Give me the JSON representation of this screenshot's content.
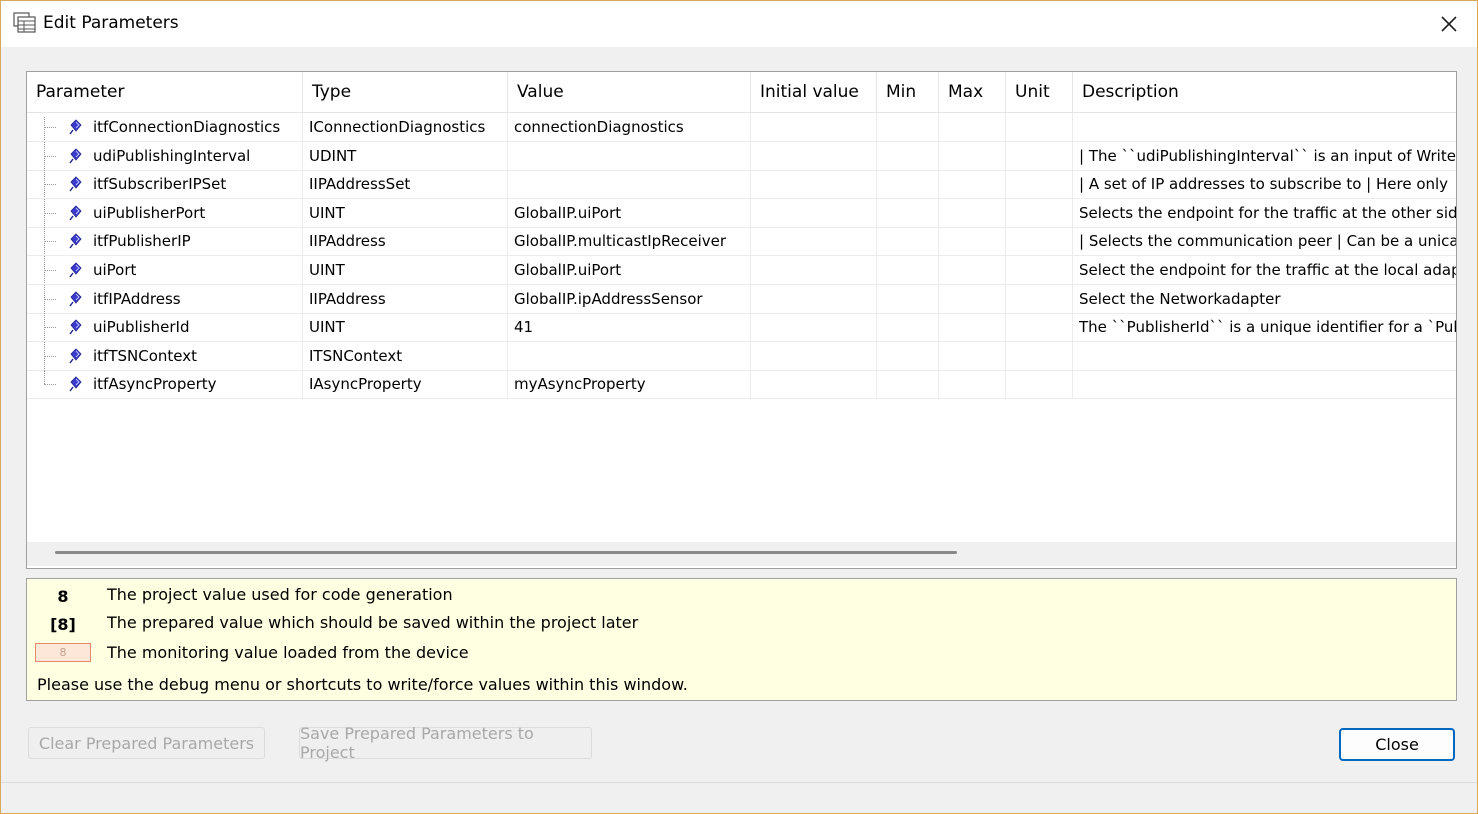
{
  "window": {
    "title": "Edit Parameters"
  },
  "grid": {
    "columns": [
      "Parameter",
      "Type",
      "Value",
      "Initial value",
      "Min",
      "Max",
      "Unit",
      "Description"
    ],
    "rows": [
      {
        "parameter": "itfConnectionDiagnostics",
        "type": "IConnectionDiagnostics",
        "value": "connectionDiagnostics",
        "initial": "",
        "min": "",
        "max": "",
        "unit": "",
        "description": ""
      },
      {
        "parameter": "udiPublishingInterval",
        "type": "UDINT",
        "value": "",
        "initial": "",
        "min": "",
        "max": "",
        "unit": "",
        "description": "| The ``udiPublishingInterval`` is an input of Writer"
      },
      {
        "parameter": "itfSubscriberIPSet",
        "type": "IIPAddressSet",
        "value": "",
        "initial": "",
        "min": "",
        "max": "",
        "unit": "",
        "description": "| A set of IP addresses to subscribe to    | Here only"
      },
      {
        "parameter": "uiPublisherPort",
        "type": "UINT",
        "value": "GlobalIP.uiPort",
        "initial": "",
        "min": "",
        "max": "",
        "unit": "",
        "description": "Selects the endpoint for the traffic at the other side"
      },
      {
        "parameter": "itfPublisherIP",
        "type": "IIPAddress",
        "value": "GlobalIP.multicastIpReceiver",
        "initial": "",
        "min": "",
        "max": "",
        "unit": "",
        "description": "| Selects the communication peer    | Can be a unicas"
      },
      {
        "parameter": "uiPort",
        "type": "UINT",
        "value": "GlobalIP.uiPort",
        "initial": "",
        "min": "",
        "max": "",
        "unit": "",
        "description": "Select the endpoint for the traffic at the local adapt"
      },
      {
        "parameter": "itfIPAddress",
        "type": "IIPAddress",
        "value": "GlobalIP.ipAddressSensor",
        "initial": "",
        "min": "",
        "max": "",
        "unit": "",
        "description": "Select the Networkadapter"
      },
      {
        "parameter": "uiPublisherId",
        "type": "UINT",
        "value": "41",
        "initial": "",
        "min": "",
        "max": "",
        "unit": "",
        "description": "The ``PublisherId`` is a unique identifier for a `Pub"
      },
      {
        "parameter": "itfTSNContext",
        "type": "ITSNContext",
        "value": "",
        "initial": "",
        "min": "",
        "max": "",
        "unit": "",
        "description": ""
      },
      {
        "parameter": "itfAsyncProperty",
        "type": "IAsyncProperty",
        "value": "myAsyncProperty",
        "initial": "",
        "min": "",
        "max": "",
        "unit": "",
        "description": ""
      }
    ]
  },
  "legend": {
    "items": [
      {
        "symbol": "8",
        "text": "The project value used for code generation"
      },
      {
        "symbol": "[8]",
        "text": "The prepared value which should be saved within the project later"
      },
      {
        "symbol": "8",
        "text": "The monitoring value loaded from the device"
      }
    ],
    "note": "Please use the debug menu or shortcuts to write/force values within this window."
  },
  "buttons": {
    "clear": "Clear Prepared Parameters",
    "save": "Save Prepared Parameters to Project",
    "close": "Close"
  },
  "colors": {
    "legend_bg": "#ffffe1",
    "close_border": "#0067c0",
    "monitor_box": "#fde7d8",
    "window_border": "#d9a95a"
  },
  "icons": {
    "title": "dialog-grid-icon",
    "row": "parameter-pin-icon",
    "close": "close-icon"
  }
}
